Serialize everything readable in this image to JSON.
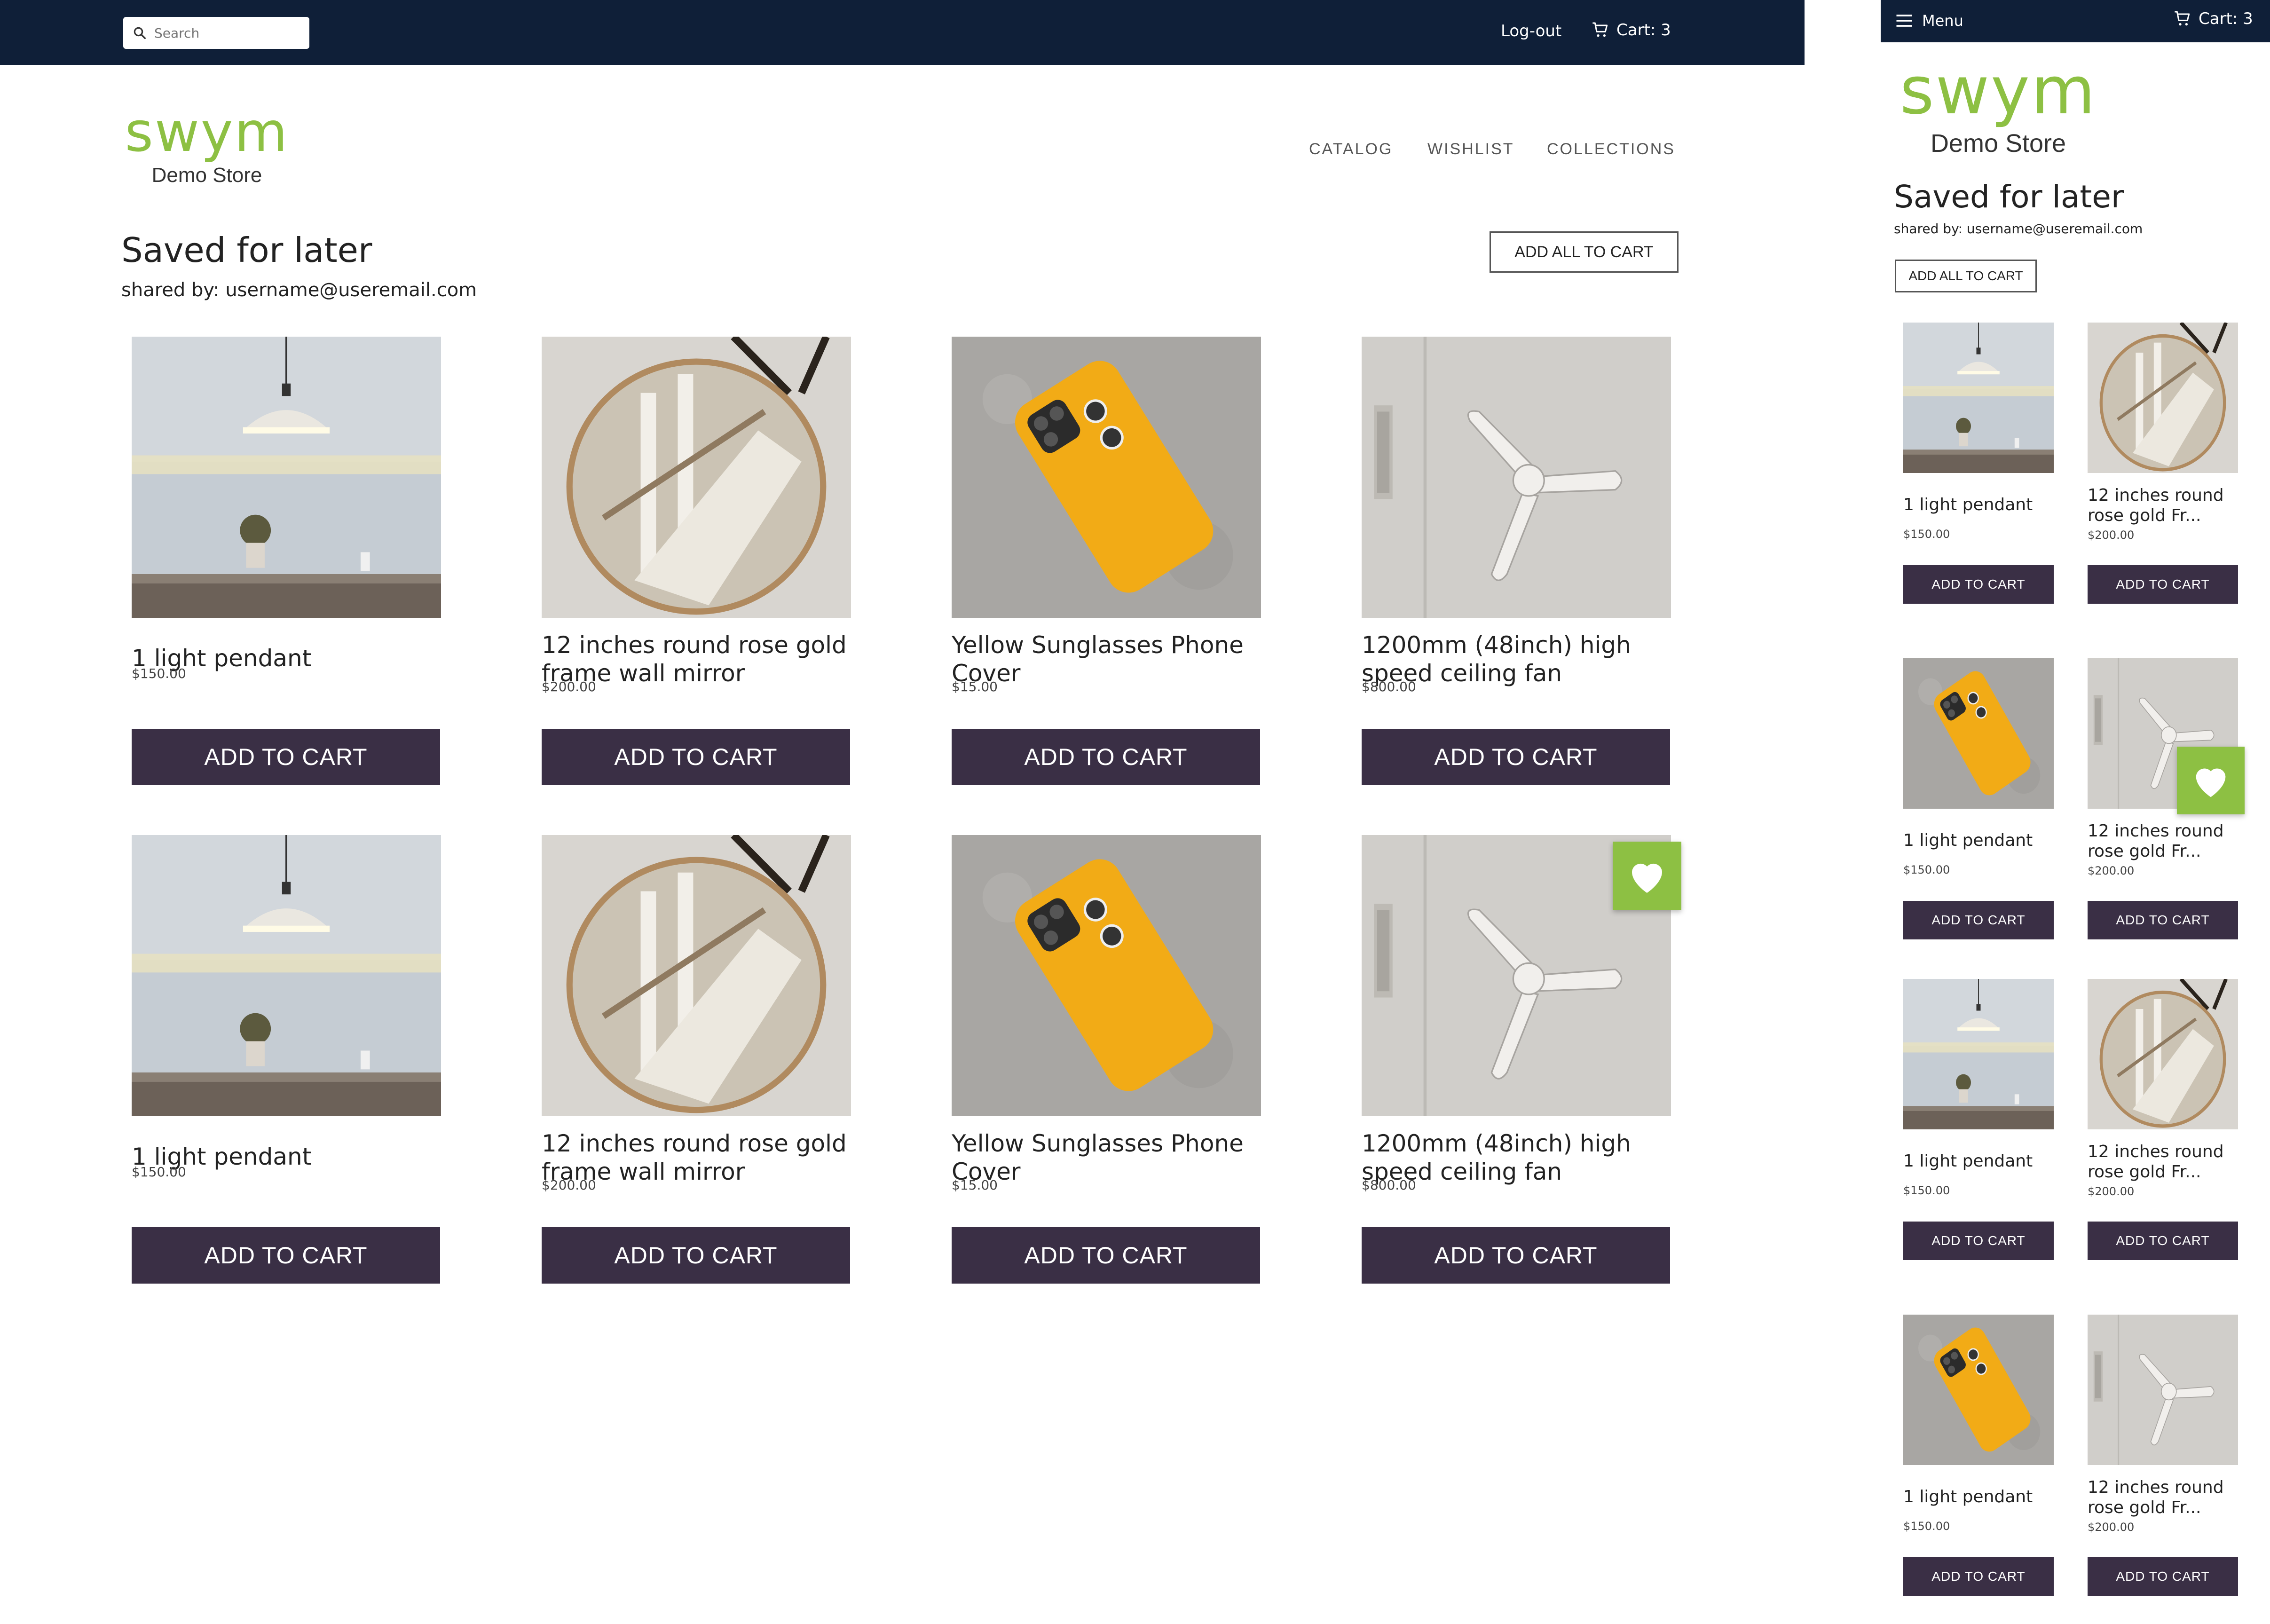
{
  "desktop": {
    "search_placeholder": "Search",
    "logout": "Log-out",
    "cart": "Cart: 3",
    "logo_word": "swym",
    "logo_sub": "Demo Store",
    "nav": [
      "CATALOG",
      "WISHLIST",
      "COLLECTIONS"
    ],
    "title": "Saved for later",
    "shared_by": "shared by: username@useremail.com",
    "add_all": "ADD ALL TO CART",
    "cart_button": "ADD TO CART",
    "products": [
      {
        "name": "1 light pendant",
        "price": "$150.00",
        "image": "pendant"
      },
      {
        "name": "12 inches round rose gold frame wall mirror",
        "price": "$200.00",
        "image": "mirror"
      },
      {
        "name": "Yellow Sunglasses Phone Cover",
        "price": "$15.00",
        "image": "phone"
      },
      {
        "name": "1200mm (48inch) high speed ceiling fan",
        "price": "$800.00",
        "image": "fan"
      },
      {
        "name": "1 light pendant",
        "price": "$150.00",
        "image": "pendant"
      },
      {
        "name": "12 inches round rose gold frame wall mirror",
        "price": "$200.00",
        "image": "mirror"
      },
      {
        "name": "Yellow Sunglasses Phone Cover",
        "price": "$15.00",
        "image": "phone"
      },
      {
        "name": "1200mm (48inch) high speed ceiling fan",
        "price": "$800.00",
        "image": "fan"
      }
    ]
  },
  "mobile": {
    "menu": "Menu",
    "cart": "Cart: 3",
    "logo_word": "swym",
    "logo_sub": "Demo Store",
    "title": "Saved for later",
    "shared_by": "shared by: username@useremail.com",
    "add_all": "ADD ALL TO CART",
    "cart_button": "ADD TO CART",
    "products": [
      {
        "name": "1 light pendant",
        "price": "$150.00",
        "image": "pendant"
      },
      {
        "name": "12 inches round rose gold Fr...",
        "price": "$200.00",
        "image": "mirror"
      },
      {
        "name": "1 light pendant",
        "price": "$150.00",
        "image": "phone"
      },
      {
        "name": "12 inches round rose gold Fr...",
        "price": "$200.00",
        "image": "fan"
      },
      {
        "name": "1 light pendant",
        "price": "$150.00",
        "image": "pendant"
      },
      {
        "name": "12 inches round rose gold Fr...",
        "price": "$200.00",
        "image": "mirror"
      },
      {
        "name": "1 light pendant",
        "price": "$150.00",
        "image": "phone"
      },
      {
        "name": "12 inches round rose gold Fr...",
        "price": "$200.00",
        "image": "fan"
      }
    ]
  },
  "colors": {
    "topbar": "#0f1f38",
    "brand_green": "#8dc043",
    "button": "#3a2f45"
  },
  "icons": [
    "search-icon",
    "cart-icon",
    "menu-icon",
    "heart-icon"
  ]
}
